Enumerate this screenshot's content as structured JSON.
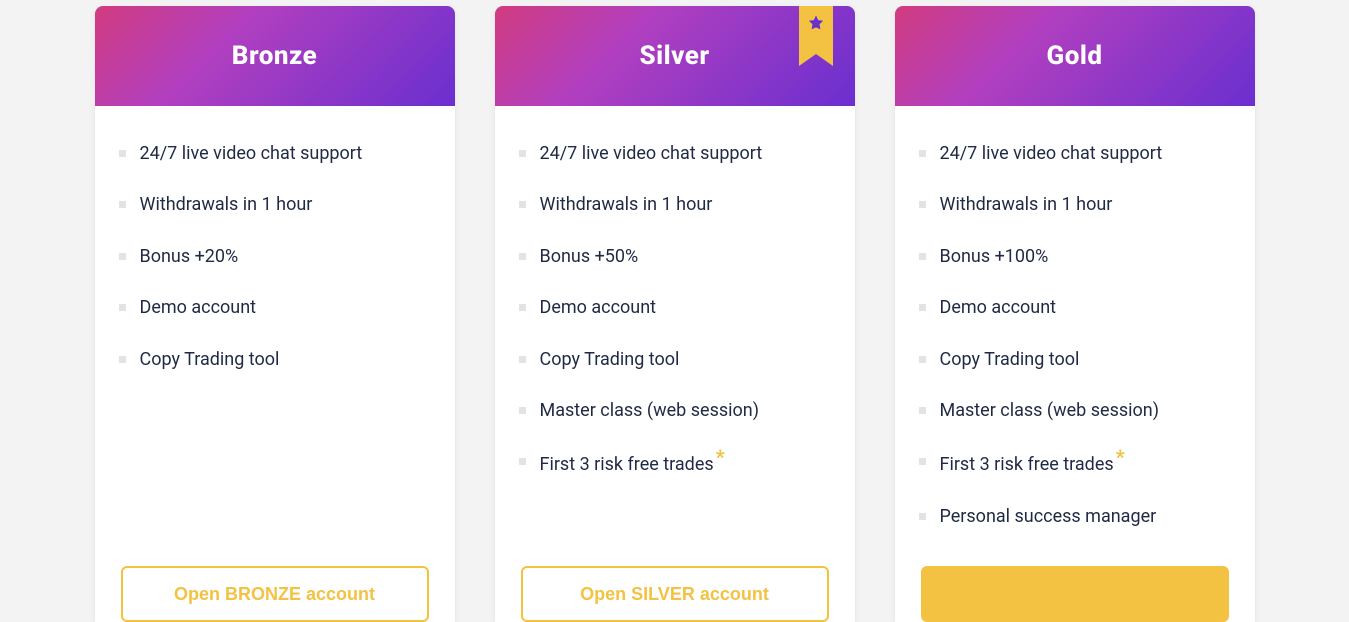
{
  "plans": [
    {
      "title": "Bronze",
      "featured": false,
      "features": [
        {
          "text": "24/7 live video chat support",
          "asterisk": false
        },
        {
          "text": "Withdrawals in 1 hour",
          "asterisk": false
        },
        {
          "text": "Bonus +20%",
          "asterisk": false
        },
        {
          "text": "Demo account",
          "asterisk": false
        },
        {
          "text": "Copy Trading tool",
          "asterisk": false
        }
      ],
      "cta": "Open BRONZE account",
      "cta_style": "outline"
    },
    {
      "title": "Silver",
      "featured": true,
      "features": [
        {
          "text": "24/7 live video chat support",
          "asterisk": false
        },
        {
          "text": "Withdrawals in 1 hour",
          "asterisk": false
        },
        {
          "text": "Bonus +50%",
          "asterisk": false
        },
        {
          "text": "Demo account",
          "asterisk": false
        },
        {
          "text": "Copy Trading tool",
          "asterisk": false
        },
        {
          "text": "Master class (web session)",
          "asterisk": false
        },
        {
          "text": "First 3 risk free trades",
          "asterisk": true
        }
      ],
      "cta": "Open SILVER account",
      "cta_style": "outline"
    },
    {
      "title": "Gold",
      "featured": false,
      "features": [
        {
          "text": "24/7 live video chat support",
          "asterisk": false
        },
        {
          "text": "Withdrawals in 1 hour",
          "asterisk": false
        },
        {
          "text": "Bonus +100%",
          "asterisk": false
        },
        {
          "text": "Demo account",
          "asterisk": false
        },
        {
          "text": "Copy Trading tool",
          "asterisk": false
        },
        {
          "text": "Master class (web session)",
          "asterisk": false
        },
        {
          "text": "First 3 risk free trades",
          "asterisk": true
        },
        {
          "text": "Personal success manager",
          "asterisk": false
        }
      ],
      "cta": "",
      "cta_style": "solid"
    }
  ],
  "asterisk_symbol": "*"
}
